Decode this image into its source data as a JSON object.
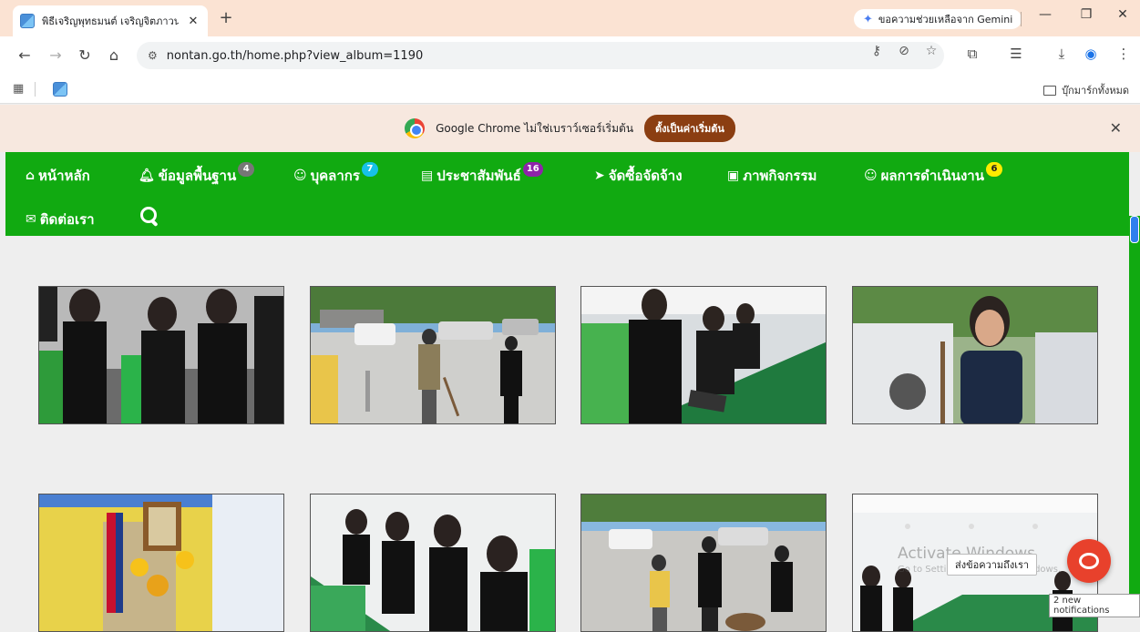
{
  "browser": {
    "tab_title": "พิธีเจริญพุทธมนต์ เจริญจิตภาวนา (ม",
    "new_tab_icon": "plus-icon",
    "gemini_label": "ขอความช่วยเหลือจาก Gemini",
    "url": "nontan.go.th/home.php?view_album=1190",
    "bookmarks_all_label": "บุ๊กมาร์กทั้งหมด",
    "infobar_text": "Google Chrome ไม่ใช่เบราว์เซอร์เริ่มต้น",
    "infobar_button": "ตั้งเป็นค่าเริ่มต้น"
  },
  "nav": {
    "home": "หน้าหลัก",
    "basic_info": "ข้อมูลพื้นฐาน",
    "basic_info_count": "4",
    "personnel": "บุคลากร",
    "personnel_count": "7",
    "pr": "ประชาสัมพันธ์",
    "pr_count": "16",
    "procurement": "จัดซื้อจัดจ้าง",
    "activities": "ภาพกิจกรรม",
    "performance": "ผลการดำเนินงาน",
    "performance_count": "6",
    "contact": "ติดต่อเรา"
  },
  "colors": {
    "nav_green": "#11aa11",
    "badge_gray": "#777777",
    "badge_cyan": "#17c1e8",
    "badge_purple": "#8e24aa",
    "badge_yellow": "#ffeb00",
    "default_button": "#8b3e12",
    "chat_red": "#e8412c"
  },
  "gallery": {
    "photos": [
      "photo-1",
      "photo-2",
      "photo-3",
      "photo-4",
      "photo-5",
      "photo-6",
      "photo-7",
      "photo-8"
    ]
  },
  "overlay": {
    "chat_label": "ส่งข้อความถึงเรา",
    "activate_title": "Activate Windows",
    "activate_sub": "Go to Settings to activate Windows.",
    "notifications": "2 new notifications"
  }
}
